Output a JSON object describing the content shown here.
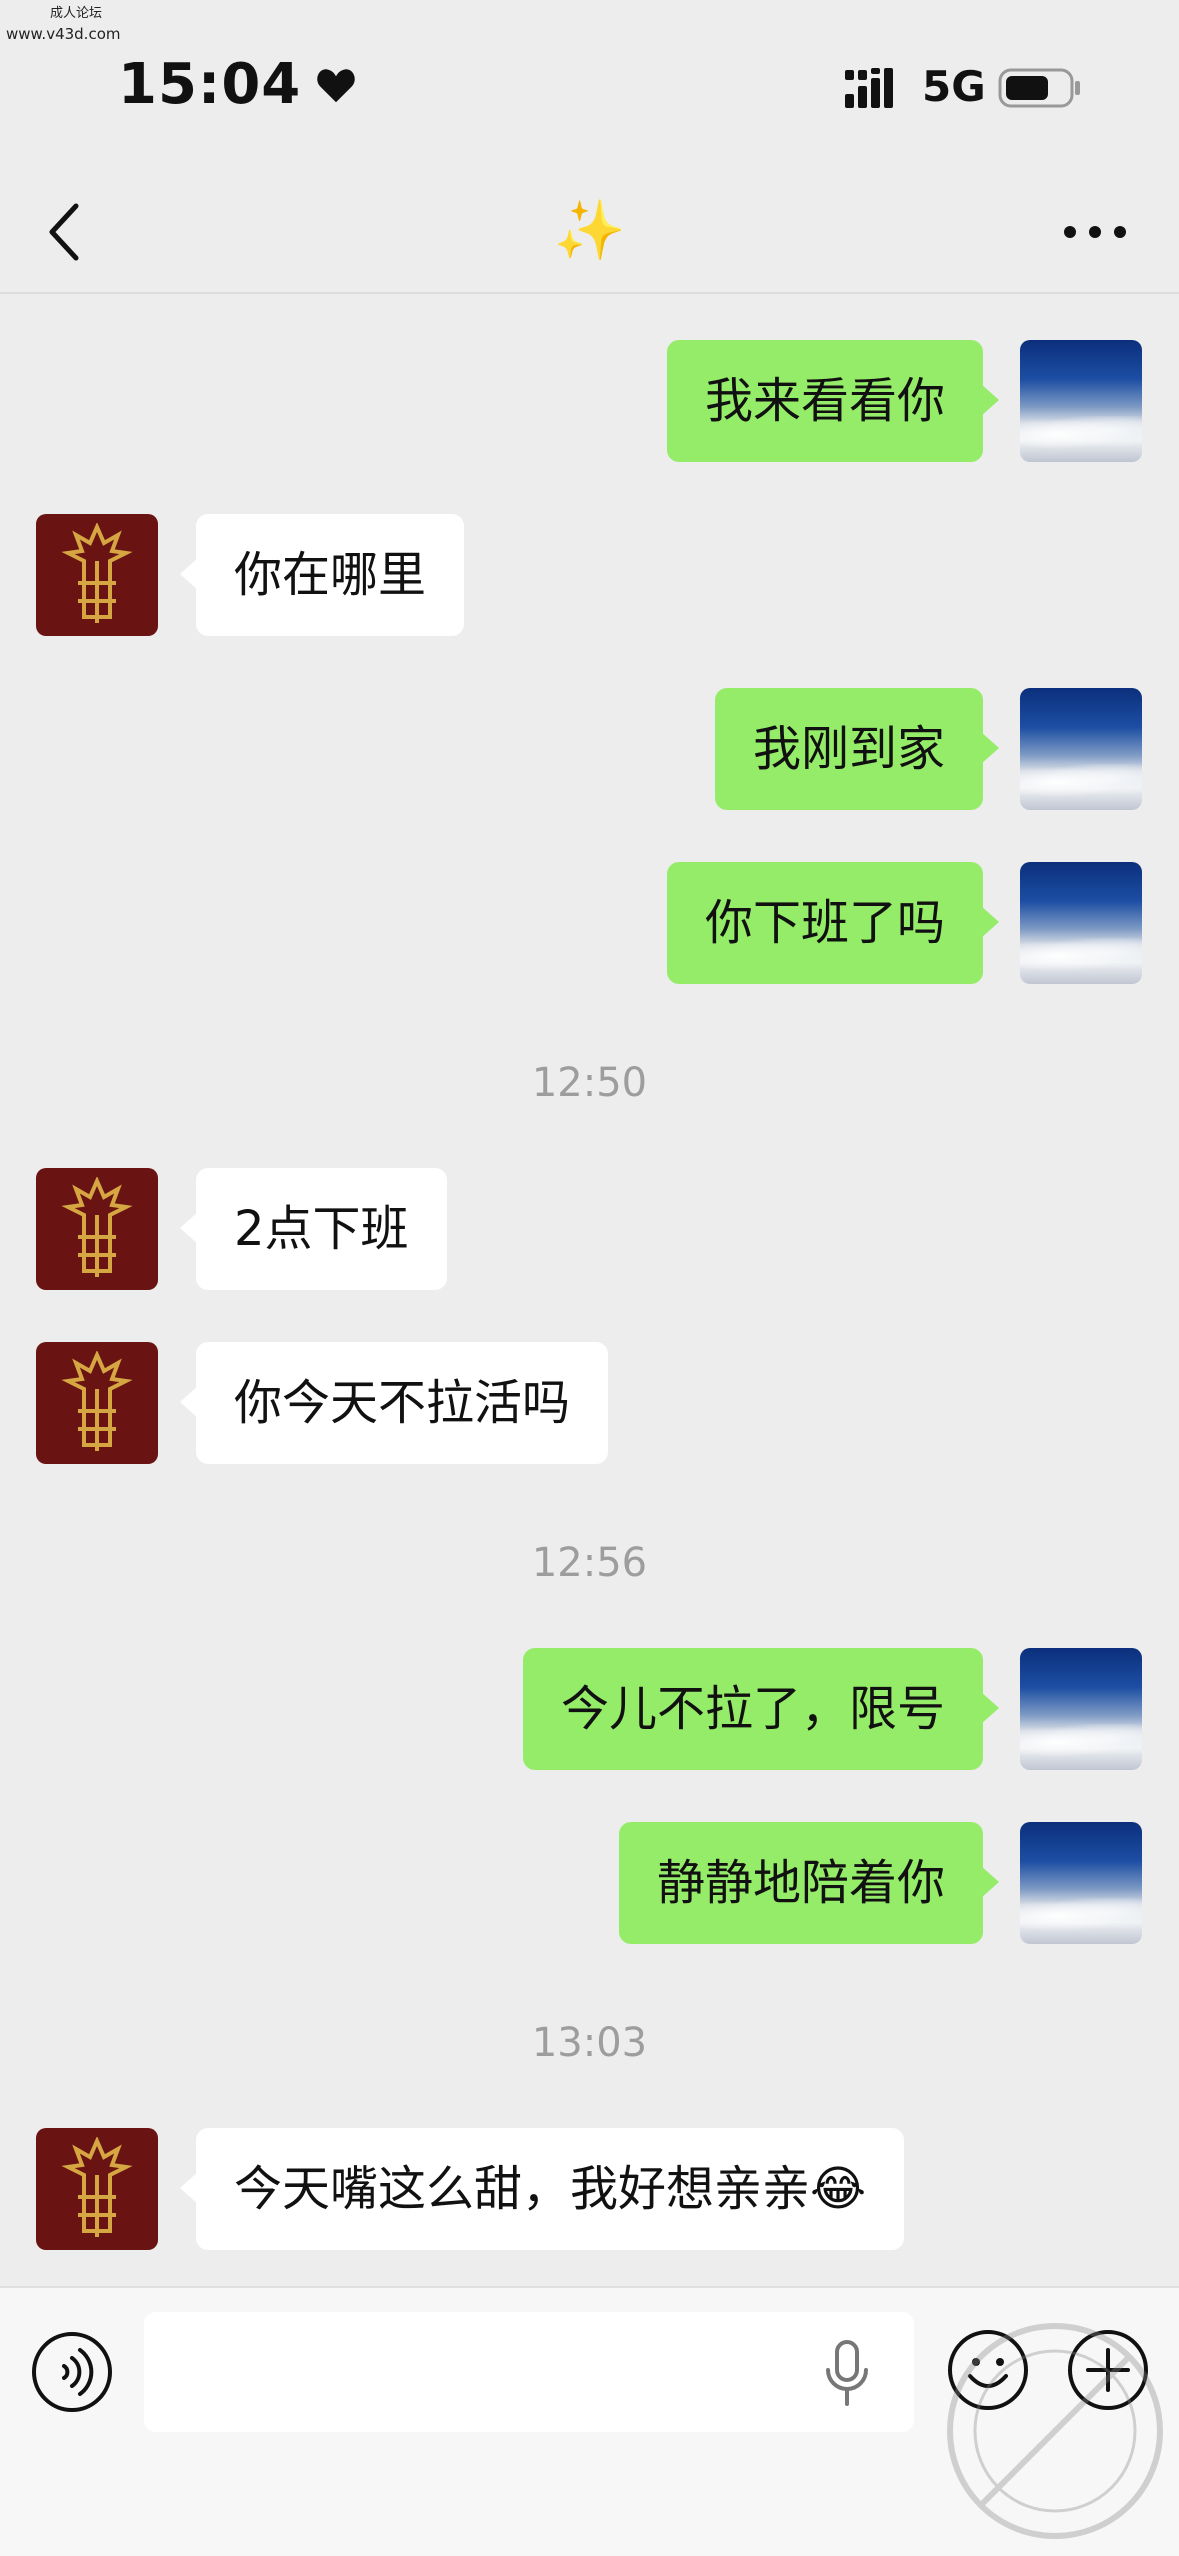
{
  "watermark": {
    "line1": "成人论坛",
    "line2": "www.v43d.com"
  },
  "status_bar": {
    "time": "15:04",
    "network": "5G"
  },
  "nav": {
    "title": "✨"
  },
  "messages": [
    {
      "type": "self",
      "text": "我来看看你"
    },
    {
      "type": "other",
      "text": "你在哪里"
    },
    {
      "type": "self",
      "text": "我刚到家"
    },
    {
      "type": "self",
      "text": "你下班了吗"
    },
    {
      "type": "time",
      "text": "12:50"
    },
    {
      "type": "other",
      "text": "2点下班"
    },
    {
      "type": "other",
      "text": "你今天不拉活吗"
    },
    {
      "type": "time",
      "text": "12:56"
    },
    {
      "type": "self",
      "text": "今儿不拉了，限号"
    },
    {
      "type": "self",
      "text": "静静地陪着你"
    },
    {
      "type": "time",
      "text": "13:03"
    },
    {
      "type": "other",
      "text": "今天嘴这么甜，我好想亲亲😂"
    }
  ],
  "input": {
    "value": "",
    "placeholder": ""
  },
  "icons": {
    "voice": "voice-mode-icon",
    "mic": "microphone-icon",
    "emoji": "emoji-icon",
    "plus": "plus-icon"
  },
  "colors": {
    "self_bubble": "#95ec69",
    "other_bubble": "#ffffff",
    "background": "#ededed"
  }
}
